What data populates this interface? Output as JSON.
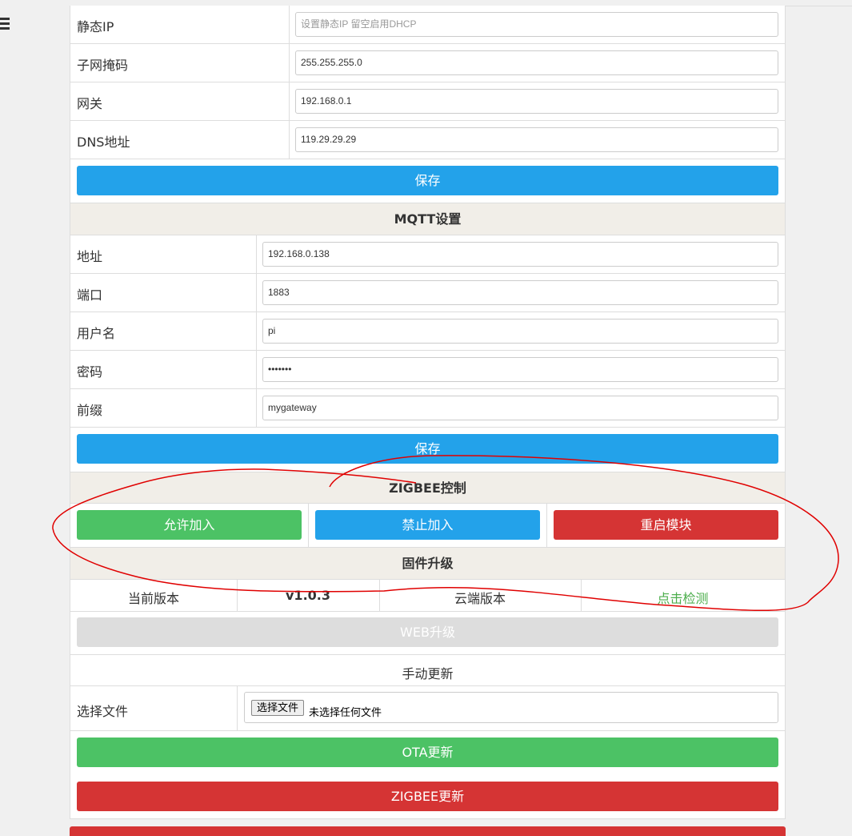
{
  "network": {
    "static_ip": {
      "label": "静态IP",
      "placeholder": "设置静态IP 留空启用DHCP"
    },
    "subnet": {
      "label": "子网掩码",
      "value": "255.255.255.0"
    },
    "gateway": {
      "label": "网关",
      "value": "192.168.0.1"
    },
    "dns": {
      "label": "DNS地址",
      "value": "119.29.29.29"
    },
    "save_label": "保存"
  },
  "mqtt": {
    "title": "MQTT设置",
    "address": {
      "label": "地址",
      "value": "192.168.0.138"
    },
    "port": {
      "label": "端口",
      "value": "1883"
    },
    "username": {
      "label": "用户名",
      "value": "pi"
    },
    "password": {
      "label": "密码",
      "value": "•••••••"
    },
    "prefix": {
      "label": "前缀",
      "value": "mygateway"
    },
    "save_label": "保存"
  },
  "zigbee": {
    "title": "ZIGBEE控制",
    "allow_join": "允许加入",
    "forbid_join": "禁止加入",
    "restart": "重启模块"
  },
  "firmware": {
    "title": "固件升级",
    "current_label": "当前版本",
    "current_value": "v1.0.3",
    "cloud_label": "云端版本",
    "check_link": "点击检测",
    "web_upgrade": "WEB升级",
    "manual_title": "手动更新",
    "file_label": "选择文件",
    "file_button": "选择文件",
    "file_status": "未选择任何文件",
    "ota_update": "OTA更新",
    "zigbee_update": "ZIGBEE更新"
  },
  "colors": {
    "blue": "#23a2ea",
    "green": "#4cc265",
    "red": "#d53434",
    "annotation": "#e00000"
  }
}
